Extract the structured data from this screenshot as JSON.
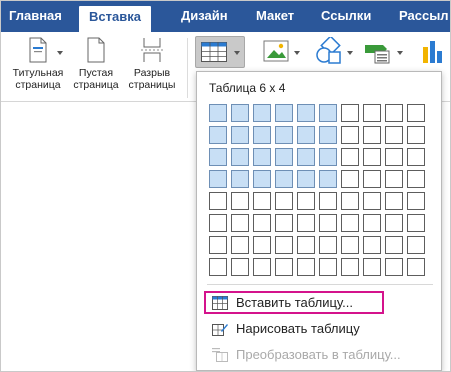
{
  "ribbon_tabs": {
    "home": "Главная",
    "insert": "Вставка",
    "design": "Дизайн",
    "layout": "Макет",
    "references": "Ссылки",
    "mailings": "Рассыл"
  },
  "ribbon_buttons": {
    "cover_page": [
      "Титульная",
      "страница"
    ],
    "blank_page": [
      "Пустая",
      "страница"
    ],
    "page_break": [
      "Разрыв",
      "страницы"
    ]
  },
  "table_dropdown": {
    "title": "Таблица 6 x 4",
    "grid": {
      "columns": 10,
      "rows": 8,
      "selected_columns": 6,
      "selected_rows": 4
    },
    "menu": {
      "insert_table": "Вставить таблицу...",
      "draw_table": "Нарисовать таблицу",
      "convert_to_table": "Преобразовать в таблицу..."
    }
  },
  "colors": {
    "ribbon_tab_bar": "#2b579a",
    "grid_selected": "#c8dff5",
    "highlight_box": "#d4138c"
  }
}
